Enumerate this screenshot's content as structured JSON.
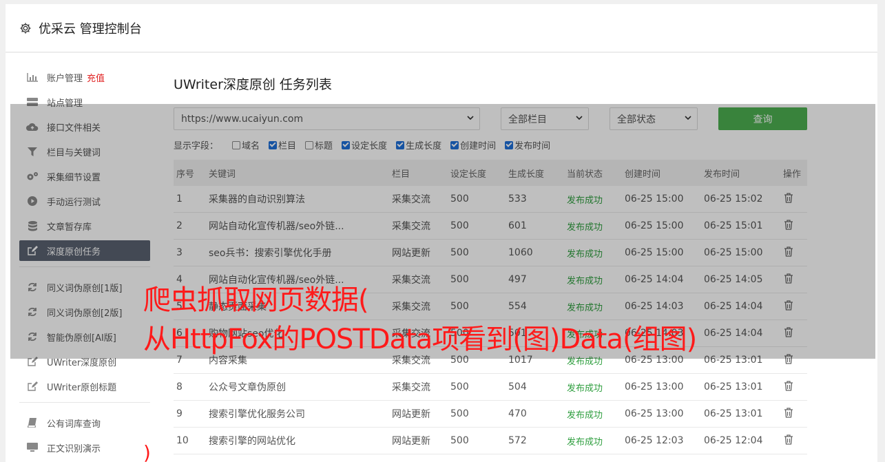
{
  "header": {
    "title": "优采云 管理控制台"
  },
  "sidebar": {
    "items": [
      {
        "label": "账户管理",
        "extra": "充值",
        "icon": "bar-chart-icon"
      },
      {
        "label": "站点管理",
        "icon": "server-icon"
      },
      {
        "label": "接口文件相关",
        "icon": "cloud-upload-icon"
      },
      {
        "label": "栏目与关键词",
        "icon": "filter-icon"
      },
      {
        "label": "采集细节设置",
        "icon": "gears-icon"
      },
      {
        "label": "手动运行测试",
        "icon": "play-circle-icon"
      },
      {
        "label": "文章暂存库",
        "icon": "database-icon"
      },
      {
        "label": "深度原创任务",
        "icon": "edit-icon",
        "active": true
      },
      {
        "label": "同义词伪原创[1版]",
        "icon": "refresh-icon"
      },
      {
        "label": "同义词伪原创[2版]",
        "icon": "refresh-icon"
      },
      {
        "label": "智能伪原创[AI版]",
        "icon": "refresh-icon"
      },
      {
        "label": "UWriter深度原创",
        "icon": "edit-icon"
      },
      {
        "label": "UWriter原创标题",
        "icon": "edit-icon"
      },
      {
        "label": "公有词库查询",
        "icon": "book-icon"
      },
      {
        "label": "正文识别演示",
        "icon": "monitor-icon"
      }
    ]
  },
  "main": {
    "title": "UWriter深度原创 任务列表",
    "filters": {
      "site": "https://www.ucaiyun.com",
      "column": "全部栏目",
      "status": "全部状态",
      "query_label": "查询"
    },
    "fields": {
      "label": "显示字段：",
      "options": [
        {
          "label": "域名",
          "checked": false
        },
        {
          "label": "栏目",
          "checked": true
        },
        {
          "label": "标题",
          "checked": false
        },
        {
          "label": "设定长度",
          "checked": true
        },
        {
          "label": "生成长度",
          "checked": true
        },
        {
          "label": "创建时间",
          "checked": true
        },
        {
          "label": "发布时间",
          "checked": true
        }
      ]
    },
    "table": {
      "headers": [
        "序号",
        "关键词",
        "栏目",
        "设定长度",
        "生成长度",
        "当前状态",
        "创建时间",
        "发布时间",
        "操作"
      ],
      "rows": [
        [
          "1",
          "采集器的自动识别算法",
          "采集交流",
          "500",
          "533",
          "发布成功",
          "06-25 15:00",
          "06-25 15:02"
        ],
        [
          "2",
          "网站自动化宣传机器/seo外链...",
          "采集交流",
          "500",
          "601",
          "发布成功",
          "06-25 15:00",
          "06-25 15:01"
        ],
        [
          "3",
          "seo兵书：搜索引擎优化手册",
          "网站更新",
          "500",
          "1060",
          "发布成功",
          "06-25 15:00",
          "06-25 15:00"
        ],
        [
          "4",
          "网站自动化宣传机器/seo外链...",
          "采集交流",
          "500",
          "497",
          "发布成功",
          "06-25 14:04",
          "06-25 14:05"
        ],
        [
          "5",
          "静态页面采集",
          "采集交流",
          "500",
          "554",
          "发布成功",
          "06-25 14:03",
          "06-25 14:04"
        ],
        [
          "6",
          "购物网站seo优化",
          "采集交流",
          "500",
          "501",
          "发布成功",
          "06-25 14:03",
          "06-25 14:04"
        ],
        [
          "7",
          "内容采集",
          "采集交流",
          "500",
          "1017",
          "发布成功",
          "06-25 13:00",
          "06-25 13:01"
        ],
        [
          "8",
          "公众号文章伪原创",
          "采集交流",
          "500",
          "504",
          "发布成功",
          "06-25 13:00",
          "06-25 13:01"
        ],
        [
          "9",
          "搜索引擎优化服务公司",
          "网站更新",
          "500",
          "470",
          "发布成功",
          "06-25 13:00",
          "06-25 13:01"
        ],
        [
          "10",
          "搜索引擎的网站优化",
          "网站更新",
          "500",
          "572",
          "发布成功",
          "06-25 12:03",
          "06-25 12:04"
        ]
      ]
    }
  },
  "overlay": {
    "line1": "爬虫抓取网页数据(",
    "line2": "从HttpFox的POSTData项看到(图)Data(组图)",
    "tail": ")"
  }
}
